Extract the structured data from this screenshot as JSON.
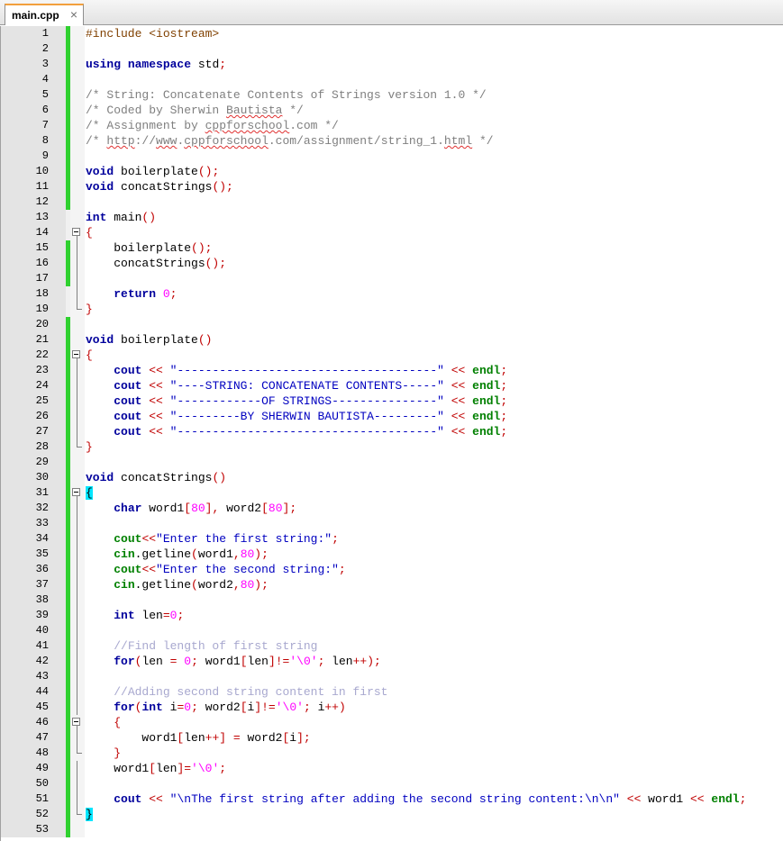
{
  "tab": {
    "filename": "main.cpp",
    "close_glyph": "×"
  },
  "colors": {
    "keyword": "#00009c",
    "comment": "#7f7f7f",
    "string": "#0000c0",
    "number": "#ff00ff",
    "operator": "#c00000",
    "changed_line": "#2fd12f",
    "brace_highlight": "#00e6ff"
  },
  "lines": [
    {
      "n": "1",
      "mod": true,
      "fold": "none",
      "tokens": [
        [
          "pp",
          "#include <iostream>"
        ]
      ]
    },
    {
      "n": "2",
      "mod": true,
      "fold": "none",
      "tokens": []
    },
    {
      "n": "3",
      "mod": true,
      "fold": "none",
      "tokens": [
        [
          "kw",
          "using"
        ],
        [
          "id",
          " "
        ],
        [
          "kw",
          "namespace"
        ],
        [
          "id",
          " std"
        ],
        [
          "op",
          ";"
        ]
      ]
    },
    {
      "n": "4",
      "mod": true,
      "fold": "none",
      "tokens": []
    },
    {
      "n": "5",
      "mod": true,
      "fold": "none",
      "tokens": [
        [
          "cm",
          "/* String: Concatenate Contents of Strings version 1.0 */"
        ]
      ]
    },
    {
      "n": "6",
      "mod": true,
      "fold": "none",
      "tokens": [
        [
          "cm",
          "/* Coded by Sherwin "
        ],
        [
          "cm sq",
          "Bautista"
        ],
        [
          "cm",
          " */"
        ]
      ]
    },
    {
      "n": "7",
      "mod": true,
      "fold": "none",
      "tokens": [
        [
          "cm",
          "/* Assignment by "
        ],
        [
          "cm sq",
          "cppforschool"
        ],
        [
          "cm",
          ".com */"
        ]
      ]
    },
    {
      "n": "8",
      "mod": true,
      "fold": "none",
      "tokens": [
        [
          "cm",
          "/* "
        ],
        [
          "cm sq",
          "http"
        ],
        [
          "cm",
          "://"
        ],
        [
          "cm sq",
          "www"
        ],
        [
          "cm",
          "."
        ],
        [
          "cm sq",
          "cppforschool"
        ],
        [
          "cm",
          ".com/assignment/string_1."
        ],
        [
          "cm sq",
          "html"
        ],
        [
          "cm",
          " */"
        ]
      ]
    },
    {
      "n": "9",
      "mod": true,
      "fold": "none",
      "tokens": []
    },
    {
      "n": "10",
      "mod": true,
      "fold": "none",
      "tokens": [
        [
          "kw",
          "void"
        ],
        [
          "id",
          " boilerplate"
        ],
        [
          "op",
          "();"
        ]
      ]
    },
    {
      "n": "11",
      "mod": true,
      "fold": "none",
      "tokens": [
        [
          "kw",
          "void"
        ],
        [
          "id",
          " concatStrings"
        ],
        [
          "op",
          "();"
        ]
      ]
    },
    {
      "n": "12",
      "mod": true,
      "fold": "none",
      "tokens": []
    },
    {
      "n": "13",
      "mod": false,
      "fold": "none",
      "tokens": [
        [
          "kw",
          "int"
        ],
        [
          "id",
          " main"
        ],
        [
          "op",
          "()"
        ]
      ]
    },
    {
      "n": "14",
      "mod": false,
      "fold": "box",
      "tokens": [
        [
          "op",
          "{"
        ]
      ]
    },
    {
      "n": "15",
      "mod": true,
      "fold": "line",
      "tokens": [
        [
          "id",
          "    boilerplate"
        ],
        [
          "op",
          "();"
        ]
      ]
    },
    {
      "n": "16",
      "mod": true,
      "fold": "line",
      "tokens": [
        [
          "id",
          "    concatStrings"
        ],
        [
          "op",
          "();"
        ]
      ]
    },
    {
      "n": "17",
      "mod": true,
      "fold": "line",
      "tokens": []
    },
    {
      "n": "18",
      "mod": false,
      "fold": "line",
      "tokens": [
        [
          "id",
          "    "
        ],
        [
          "kw",
          "return"
        ],
        [
          "id",
          " "
        ],
        [
          "num",
          "0"
        ],
        [
          "op",
          ";"
        ]
      ]
    },
    {
      "n": "19",
      "mod": false,
      "fold": "end",
      "tokens": [
        [
          "op",
          "}"
        ]
      ]
    },
    {
      "n": "20",
      "mod": true,
      "fold": "none",
      "tokens": []
    },
    {
      "n": "21",
      "mod": true,
      "fold": "none",
      "tokens": [
        [
          "kw",
          "void"
        ],
        [
          "id",
          " boilerplate"
        ],
        [
          "op",
          "()"
        ]
      ]
    },
    {
      "n": "22",
      "mod": true,
      "fold": "box",
      "tokens": [
        [
          "op",
          "{"
        ]
      ]
    },
    {
      "n": "23",
      "mod": true,
      "fold": "line",
      "tokens": [
        [
          "id",
          "    "
        ],
        [
          "kw",
          "cout"
        ],
        [
          "id",
          " "
        ],
        [
          "op",
          "<<"
        ],
        [
          "id",
          " "
        ],
        [
          "str",
          "\"-------------------------------------\""
        ],
        [
          "id",
          " "
        ],
        [
          "op",
          "<<"
        ],
        [
          "id",
          " "
        ],
        [
          "kw green",
          "endl"
        ],
        [
          "op",
          ";"
        ]
      ]
    },
    {
      "n": "24",
      "mod": true,
      "fold": "line",
      "tokens": [
        [
          "id",
          "    "
        ],
        [
          "kw",
          "cout"
        ],
        [
          "id",
          " "
        ],
        [
          "op",
          "<<"
        ],
        [
          "id",
          " "
        ],
        [
          "str",
          "\"----STRING: CONCATENATE CONTENTS-----\""
        ],
        [
          "id",
          " "
        ],
        [
          "op",
          "<<"
        ],
        [
          "id",
          " "
        ],
        [
          "kw green",
          "endl"
        ],
        [
          "op",
          ";"
        ]
      ]
    },
    {
      "n": "25",
      "mod": true,
      "fold": "line",
      "tokens": [
        [
          "id",
          "    "
        ],
        [
          "kw",
          "cout"
        ],
        [
          "id",
          " "
        ],
        [
          "op",
          "<<"
        ],
        [
          "id",
          " "
        ],
        [
          "str",
          "\"------------OF STRINGS---------------\""
        ],
        [
          "id",
          " "
        ],
        [
          "op",
          "<<"
        ],
        [
          "id",
          " "
        ],
        [
          "kw green",
          "endl"
        ],
        [
          "op",
          ";"
        ]
      ]
    },
    {
      "n": "26",
      "mod": true,
      "fold": "line",
      "tokens": [
        [
          "id",
          "    "
        ],
        [
          "kw",
          "cout"
        ],
        [
          "id",
          " "
        ],
        [
          "op",
          "<<"
        ],
        [
          "id",
          " "
        ],
        [
          "str",
          "\"---------BY SHERWIN BAUTISTA---------\""
        ],
        [
          "id",
          " "
        ],
        [
          "op",
          "<<"
        ],
        [
          "id",
          " "
        ],
        [
          "kw green",
          "endl"
        ],
        [
          "op",
          ";"
        ]
      ]
    },
    {
      "n": "27",
      "mod": true,
      "fold": "line",
      "tokens": [
        [
          "id",
          "    "
        ],
        [
          "kw",
          "cout"
        ],
        [
          "id",
          " "
        ],
        [
          "op",
          "<<"
        ],
        [
          "id",
          " "
        ],
        [
          "str",
          "\"-------------------------------------\""
        ],
        [
          "id",
          " "
        ],
        [
          "op",
          "<<"
        ],
        [
          "id",
          " "
        ],
        [
          "kw green",
          "endl"
        ],
        [
          "op",
          ";"
        ]
      ]
    },
    {
      "n": "28",
      "mod": true,
      "fold": "end",
      "tokens": [
        [
          "op",
          "}"
        ]
      ]
    },
    {
      "n": "29",
      "mod": true,
      "fold": "none",
      "tokens": []
    },
    {
      "n": "30",
      "mod": true,
      "fold": "none",
      "tokens": [
        [
          "kw",
          "void"
        ],
        [
          "id",
          " concatStrings"
        ],
        [
          "op",
          "()"
        ]
      ]
    },
    {
      "n": "31",
      "mod": true,
      "fold": "box",
      "tokens": [
        [
          "hl",
          "{"
        ]
      ]
    },
    {
      "n": "32",
      "mod": true,
      "fold": "line",
      "tokens": [
        [
          "id",
          "    "
        ],
        [
          "kw",
          "char"
        ],
        [
          "id",
          " word1"
        ],
        [
          "op",
          "["
        ],
        [
          "num",
          "80"
        ],
        [
          "op",
          "],"
        ],
        [
          "id",
          " word2"
        ],
        [
          "op",
          "["
        ],
        [
          "num",
          "80"
        ],
        [
          "op",
          "];"
        ]
      ]
    },
    {
      "n": "33",
      "mod": true,
      "fold": "line",
      "tokens": []
    },
    {
      "n": "34",
      "mod": true,
      "fold": "line",
      "tokens": [
        [
          "id",
          "    "
        ],
        [
          "kw green",
          "cout"
        ],
        [
          "op",
          "<<"
        ],
        [
          "str",
          "\"Enter the first string:\""
        ],
        [
          "op",
          ";"
        ]
      ]
    },
    {
      "n": "35",
      "mod": true,
      "fold": "line",
      "tokens": [
        [
          "id",
          "    "
        ],
        [
          "kw green",
          "cin"
        ],
        [
          "id",
          ".getline"
        ],
        [
          "op",
          "("
        ],
        [
          "id",
          "word1"
        ],
        [
          "op",
          ","
        ],
        [
          "num",
          "80"
        ],
        [
          "op",
          ");"
        ]
      ]
    },
    {
      "n": "36",
      "mod": true,
      "fold": "line",
      "tokens": [
        [
          "id",
          "    "
        ],
        [
          "kw green",
          "cout"
        ],
        [
          "op",
          "<<"
        ],
        [
          "str",
          "\"Enter the second string:\""
        ],
        [
          "op",
          ";"
        ]
      ]
    },
    {
      "n": "37",
      "mod": true,
      "fold": "line",
      "tokens": [
        [
          "id",
          "    "
        ],
        [
          "kw green",
          "cin"
        ],
        [
          "id",
          ".getline"
        ],
        [
          "op",
          "("
        ],
        [
          "id",
          "word2"
        ],
        [
          "op",
          ","
        ],
        [
          "num",
          "80"
        ],
        [
          "op",
          ");"
        ]
      ]
    },
    {
      "n": "38",
      "mod": true,
      "fold": "line",
      "tokens": []
    },
    {
      "n": "39",
      "mod": true,
      "fold": "line",
      "tokens": [
        [
          "id",
          "    "
        ],
        [
          "kw",
          "int"
        ],
        [
          "id",
          " len"
        ],
        [
          "op",
          "="
        ],
        [
          "num",
          "0"
        ],
        [
          "op",
          ";"
        ]
      ]
    },
    {
      "n": "40",
      "mod": true,
      "fold": "line",
      "tokens": []
    },
    {
      "n": "41",
      "mod": true,
      "fold": "line",
      "tokens": [
        [
          "id",
          "    "
        ],
        [
          "cm2",
          "//Find length of first string"
        ]
      ]
    },
    {
      "n": "42",
      "mod": true,
      "fold": "line",
      "tokens": [
        [
          "id",
          "    "
        ],
        [
          "kw",
          "for"
        ],
        [
          "op",
          "("
        ],
        [
          "id",
          "len "
        ],
        [
          "op",
          "="
        ],
        [
          "id",
          " "
        ],
        [
          "num",
          "0"
        ],
        [
          "op",
          ";"
        ],
        [
          "id",
          " word1"
        ],
        [
          "op",
          "["
        ],
        [
          "id",
          "len"
        ],
        [
          "op",
          "]!="
        ],
        [
          "num",
          "'\\0'"
        ],
        [
          "op",
          ";"
        ],
        [
          "id",
          " len"
        ],
        [
          "op",
          "++);"
        ]
      ]
    },
    {
      "n": "43",
      "mod": true,
      "fold": "line",
      "tokens": []
    },
    {
      "n": "44",
      "mod": true,
      "fold": "line",
      "tokens": [
        [
          "id",
          "    "
        ],
        [
          "cm2",
          "//Adding second string content in first"
        ]
      ]
    },
    {
      "n": "45",
      "mod": true,
      "fold": "line",
      "tokens": [
        [
          "id",
          "    "
        ],
        [
          "kw",
          "for"
        ],
        [
          "op",
          "("
        ],
        [
          "kw",
          "int"
        ],
        [
          "id",
          " i"
        ],
        [
          "op",
          "="
        ],
        [
          "num",
          "0"
        ],
        [
          "op",
          ";"
        ],
        [
          "id",
          " word2"
        ],
        [
          "op",
          "["
        ],
        [
          "id",
          "i"
        ],
        [
          "op",
          "]!="
        ],
        [
          "num",
          "'\\0'"
        ],
        [
          "op",
          ";"
        ],
        [
          "id",
          " i"
        ],
        [
          "op",
          "++)"
        ]
      ]
    },
    {
      "n": "46",
      "mod": true,
      "fold": "box",
      "tokens": [
        [
          "id",
          "    "
        ],
        [
          "op",
          "{"
        ]
      ]
    },
    {
      "n": "47",
      "mod": true,
      "fold": "line",
      "tokens": [
        [
          "id",
          "        word1"
        ],
        [
          "op",
          "["
        ],
        [
          "id",
          "len"
        ],
        [
          "op",
          "++]"
        ],
        [
          "id",
          " "
        ],
        [
          "op",
          "="
        ],
        [
          "id",
          " word2"
        ],
        [
          "op",
          "["
        ],
        [
          "id",
          "i"
        ],
        [
          "op",
          "];"
        ]
      ]
    },
    {
      "n": "48",
      "mod": true,
      "fold": "end",
      "tokens": [
        [
          "id",
          "    "
        ],
        [
          "op",
          "}"
        ]
      ]
    },
    {
      "n": "49",
      "mod": true,
      "fold": "line",
      "tokens": [
        [
          "id",
          "    word1"
        ],
        [
          "op",
          "["
        ],
        [
          "id",
          "len"
        ],
        [
          "op",
          "]="
        ],
        [
          "num",
          "'\\0'"
        ],
        [
          "op",
          ";"
        ]
      ]
    },
    {
      "n": "50",
      "mod": true,
      "fold": "line",
      "tokens": []
    },
    {
      "n": "51",
      "mod": true,
      "fold": "line",
      "tokens": [
        [
          "id",
          "    "
        ],
        [
          "kw",
          "cout"
        ],
        [
          "id",
          " "
        ],
        [
          "op",
          "<<"
        ],
        [
          "id",
          " "
        ],
        [
          "str",
          "\"\\nThe first string after adding the second string content:\\n\\n\""
        ],
        [
          "id",
          " "
        ],
        [
          "op",
          "<<"
        ],
        [
          "id",
          " word1 "
        ],
        [
          "op",
          "<<"
        ],
        [
          "id",
          " "
        ],
        [
          "kw green",
          "endl"
        ],
        [
          "op",
          ";"
        ]
      ]
    },
    {
      "n": "52",
      "mod": true,
      "fold": "end",
      "tokens": [
        [
          "hl",
          "}"
        ]
      ]
    },
    {
      "n": "53",
      "mod": true,
      "fold": "none",
      "tokens": []
    }
  ]
}
